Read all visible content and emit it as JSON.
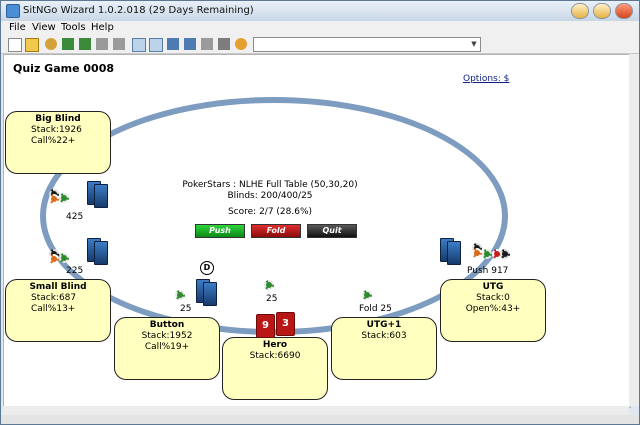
{
  "window": {
    "title": "SitNGo Wizard 1.0.2.018 (29 Days Remaining)"
  },
  "menu": [
    "File",
    "View",
    "Tools",
    "Help"
  ],
  "toolbar": {
    "combo_value": ""
  },
  "page": {
    "title": "Quiz Game 0008",
    "options_link": "Options: $"
  },
  "table_info": {
    "site_line": "PokerStars : NLHE Full Table (50,30,20)",
    "blinds_line": "Blinds: 200/400/25",
    "score_line": "Score: 2/7 (28.6%)"
  },
  "actions": {
    "push": "Push",
    "fold": "Fold",
    "quit": "Quit"
  },
  "seats": {
    "big_blind": {
      "name": "Big Blind",
      "stack": "Stack:1926",
      "info": "Call%22+"
    },
    "small_blind": {
      "name": "Small Blind",
      "stack": "Stack:687",
      "info": "Call%13+"
    },
    "button": {
      "name": "Button",
      "stack": "Stack:1952",
      "info": "Call%19+"
    },
    "hero": {
      "name": "Hero",
      "stack": "Stack:6690"
    },
    "utg1": {
      "name": "UTG+1",
      "stack": "Stack:603"
    },
    "utg": {
      "name": "UTG",
      "stack": "Stack:0",
      "info": "Open%:43+"
    }
  },
  "bets": {
    "big_blind": "425",
    "small_blind": "225",
    "button": "25",
    "hero": "25",
    "utg1": "Fold 25",
    "utg": "Push 917"
  },
  "hero_cards": [
    "9",
    "3"
  ],
  "dealer_label": "D",
  "colors": {
    "table_rail": "#7d9cbf",
    "seat_fill": "#ffffc0",
    "push": "#13a020",
    "fold": "#b01010",
    "quit": "#333333"
  }
}
